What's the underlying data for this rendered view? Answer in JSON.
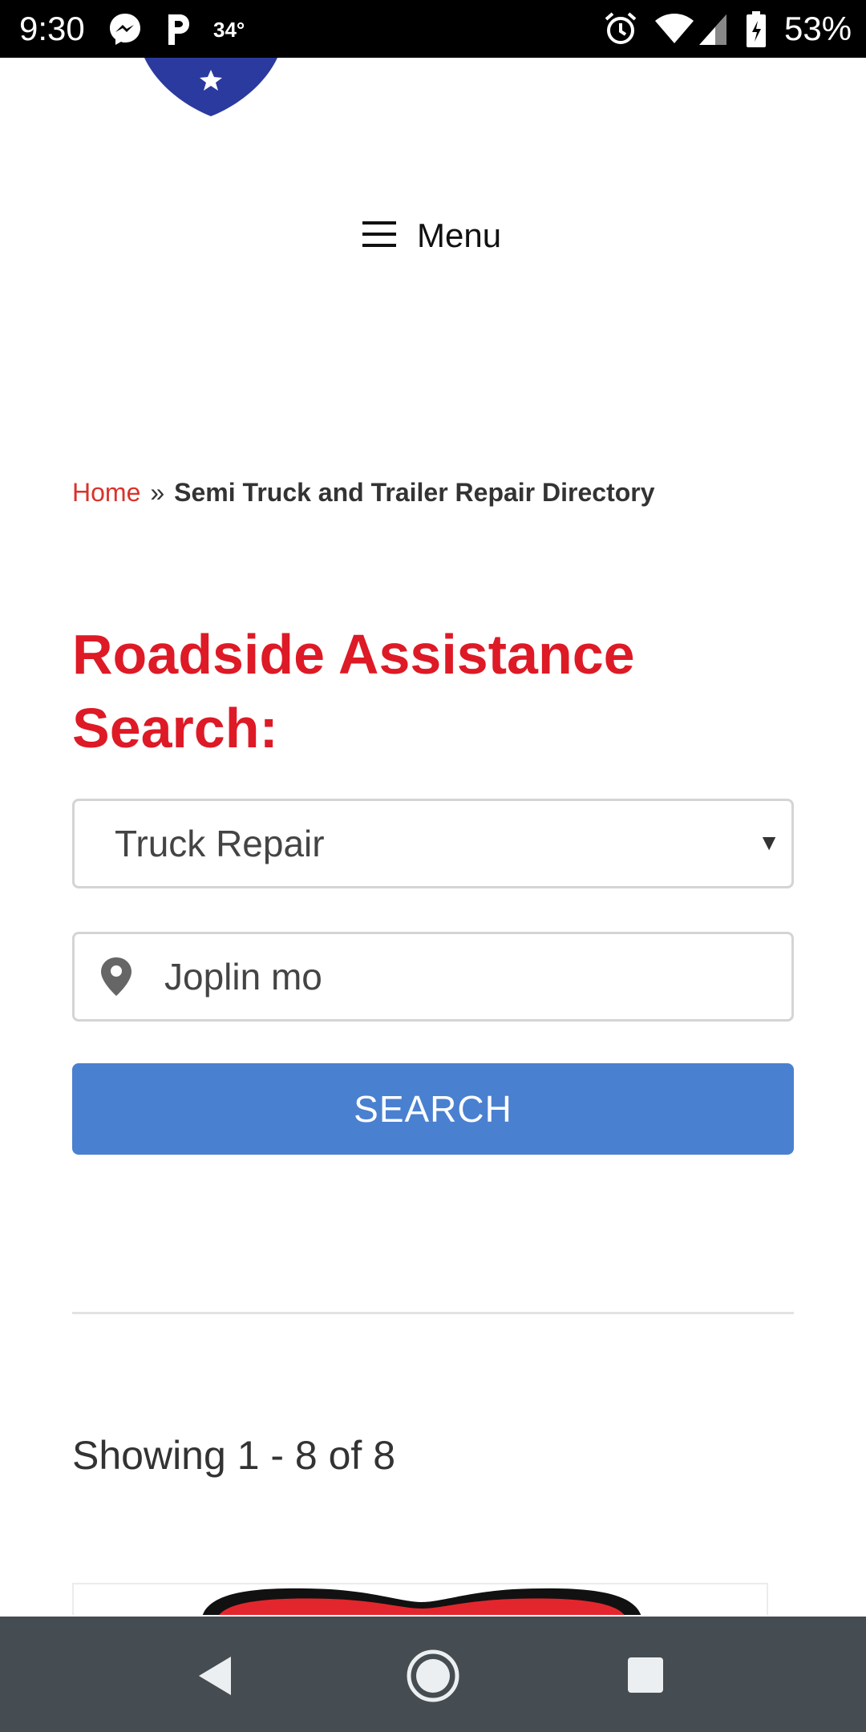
{
  "status_bar": {
    "time": "9:30",
    "temperature": "34°",
    "battery_percent": "53%",
    "icons": [
      "messenger-icon",
      "parking-p-icon",
      "alarm-icon",
      "wifi-icon",
      "signal-icon",
      "battery-icon"
    ]
  },
  "header": {
    "menu_label": "Menu"
  },
  "breadcrumb": {
    "home": "Home",
    "separator": "»",
    "current": "Semi Truck and Trailer Repair Directory"
  },
  "search": {
    "title": "Roadside Assistance Search:",
    "category_selected": "Truck Repair",
    "location_value": "Joplin mo",
    "button_label": "SEARCH"
  },
  "results": {
    "count_text": "Showing 1 - 8 of 8"
  },
  "colors": {
    "accent_red": "#dd1a26",
    "link_red": "#d9332b",
    "button_blue": "#4a80d0",
    "nav_bar": "#454c52",
    "logo_blue": "#2b3a9e"
  }
}
